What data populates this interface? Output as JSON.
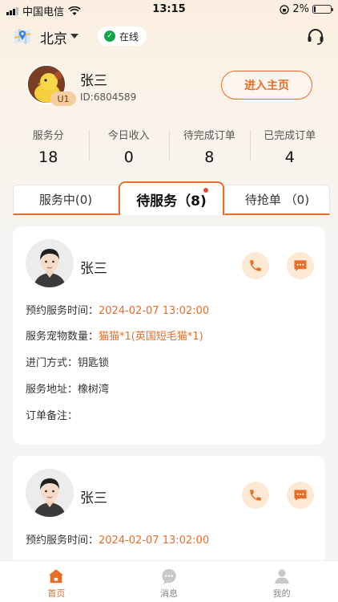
{
  "status_bar": {
    "carrier": "中国电信",
    "time": "13:15",
    "battery": "2%"
  },
  "header": {
    "city": "北京",
    "online_status": "在线"
  },
  "profile": {
    "name": "张三",
    "id": "ID:6804589",
    "level": "U1",
    "home_button": "进入主页"
  },
  "stats": [
    {
      "label": "服务分",
      "value": "18"
    },
    {
      "label": "今日收入",
      "value": "0"
    },
    {
      "label": "待完成订单",
      "value": "8"
    },
    {
      "label": "已完成订单",
      "value": "4"
    }
  ],
  "tabs": [
    {
      "label": "服务中(0)"
    },
    {
      "label": "待服务（8)"
    },
    {
      "label": "待抢单 （0)"
    }
  ],
  "orders": [
    {
      "name": "张三",
      "time_label": "预约服务时间：",
      "time": "2024-02-07 13:02:00",
      "pets_label": "服务宠物数量：",
      "pets": "猫猫*1(英国短毛猫*1)",
      "entry_label": "进门方式：",
      "entry": "钥匙锁",
      "address_label": "服务地址：",
      "address": "橡树湾",
      "note_label": "订单备注："
    },
    {
      "name": "张三",
      "time_label": "预约服务时间：",
      "time": "2024-02-07 13:02:00"
    }
  ],
  "nav": [
    {
      "label": "首页",
      "icon": "home-icon",
      "active": true
    },
    {
      "label": "消息",
      "icon": "message-icon",
      "active": false
    },
    {
      "label": "我的",
      "icon": "user-icon",
      "active": false
    }
  ],
  "colors": {
    "accent": "#e86d27",
    "online": "#17a34a",
    "badge": "#e84a3a"
  }
}
